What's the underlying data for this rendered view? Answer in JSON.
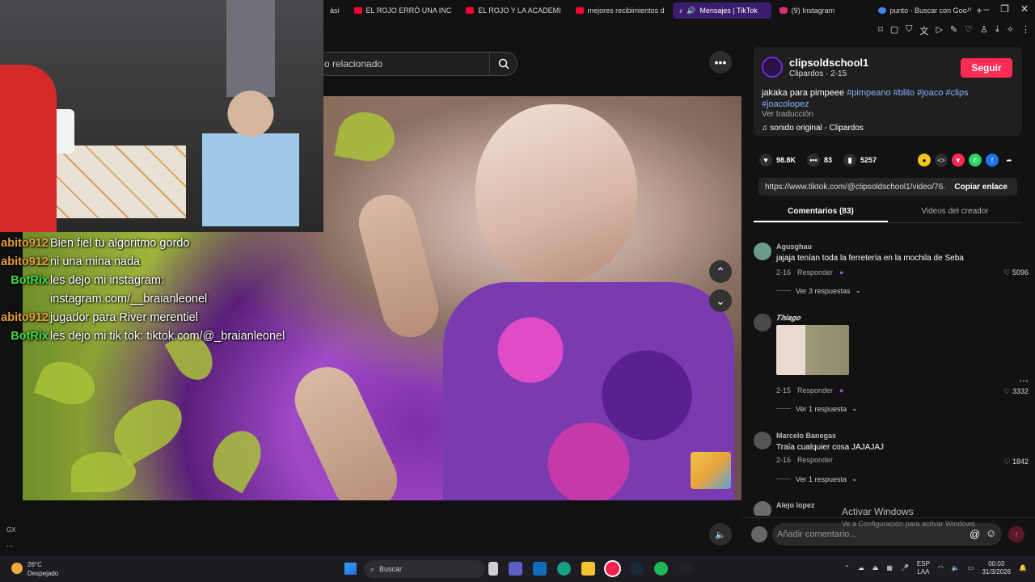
{
  "browser": {
    "tabs": [
      {
        "label": "EL ROJO ERRÓ UNA INC",
        "icon": "youtube-icon",
        "color": "#ff0033"
      },
      {
        "label": "EL ROJO Y LA ACADEMI",
        "icon": "youtube-icon",
        "color": "#ff0033"
      },
      {
        "label": "mejores recibimientos d",
        "icon": "youtube-icon",
        "color": "#ff0033"
      },
      {
        "label": "Mensajes | TikTok",
        "icon": "tiktok-icon",
        "color": "#ffffff",
        "active": true
      },
      {
        "label": "(9) Instagram",
        "icon": "instagram-icon",
        "color": "#e1306c"
      },
      {
        "label": "punto - Buscar con Goo",
        "icon": "google-icon",
        "color": "#4285f4"
      }
    ],
    "new_tab_label": "+"
  },
  "webcam_overlay": {
    "description_hidden": true
  },
  "chat": {
    "messages": [
      {
        "user": "abito912",
        "user_color": "#e6a13a",
        "text": "Bien fiel tu algoritmo gordo"
      },
      {
        "user": "abito912",
        "user_color": "#e6a13a",
        "text": "ni una mina nada"
      },
      {
        "user": "BotRix",
        "user_color": "#3ddc4a",
        "text": "les dejo mi instagram:"
      },
      {
        "user": "",
        "user_color": "#ffffff",
        "text": "instagram.com/__braianleonel"
      },
      {
        "user": "abito912",
        "user_color": "#e6a13a",
        "text": "jugador para River merentiel"
      },
      {
        "user": "BotRix",
        "user_color": "#3ddc4a",
        "text": "les dejo mi tik tok: tiktok.com/@_braianleonel"
      }
    ]
  },
  "search": {
    "text": "o relacionado"
  },
  "creator": {
    "username": "clipsoldschool1",
    "meta": "Clipardos · 2-15",
    "follow_label": "Seguir",
    "description": "jakaka para pimpeee",
    "hashtags": "#pimpeano #blito #joaco #clips #joacolopez",
    "translate_label": "Ver traducción",
    "sound": "sonido original - Clipardos"
  },
  "stats": {
    "likes": "98.8K",
    "comments": "83",
    "saves": "5257"
  },
  "link": {
    "url": "https://www.tiktok.com/@clipsoldschool1/video/76...",
    "copy_label": "Copiar enlace"
  },
  "comment_tabs": {
    "comments": "Comentarios (83)",
    "creator_videos": "Videos del creador"
  },
  "comments": [
    {
      "user": "Agusghau",
      "text": "jajaja tenían toda la ferretería en la mochila de Seba",
      "date": "2-16",
      "reply_label": "Responder",
      "likes": "5096",
      "replies": "Ver 3 respuestas"
    },
    {
      "user": "𝑻𝒉𝒊𝒂𝒈𝒐",
      "text": "",
      "date": "2-15",
      "reply_label": "Responder",
      "likes": "3332",
      "replies": "Ver 1 respuesta"
    },
    {
      "user": "Marcelo Banegas",
      "text": "Traía cualquier cosa JAJAJAJ",
      "date": "2-16",
      "reply_label": "Responder",
      "likes": "1842",
      "replies": "Ver 1 respuesta"
    },
    {
      "user": "Alejo lopez",
      "text": "",
      "date": "",
      "reply_label": "",
      "likes": "",
      "replies": ""
    }
  ],
  "add_comment": {
    "placeholder": "Añadir comentario..."
  },
  "watermark": {
    "title": "Activar Windows",
    "subtitle": "Ve a Configuración para activar Windows."
  },
  "side": {
    "gx_label": "GX",
    "more": "..."
  },
  "taskbar": {
    "weather_temp": "26°C",
    "weather_desc": "Despejado",
    "search_label": "Buscar",
    "lang": "ESP",
    "layout": "LAA",
    "time": "00:03",
    "date": "31/3/2026"
  }
}
